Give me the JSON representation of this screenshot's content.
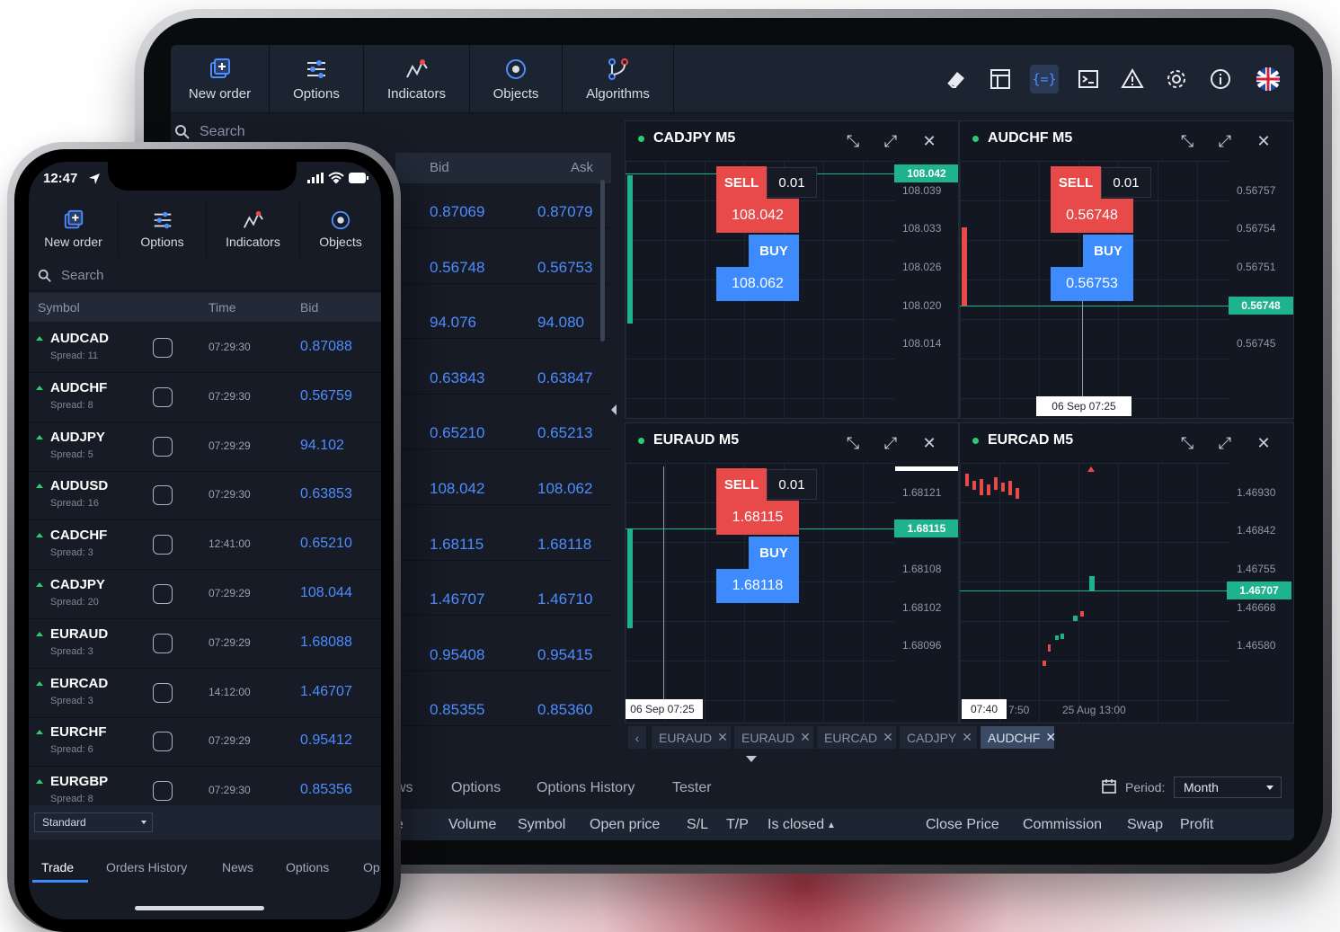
{
  "tablet": {
    "toolbar": [
      {
        "label": "New order",
        "icon": "new-order-icon"
      },
      {
        "label": "Options",
        "icon": "sliders-icon"
      },
      {
        "label": "Indicators",
        "icon": "indicators-icon"
      },
      {
        "label": "Objects",
        "icon": "objects-icon"
      },
      {
        "label": "Algorithms",
        "icon": "algorithms-icon"
      }
    ],
    "search_placeholder": "Search",
    "quotes": {
      "bid_header": "Bid",
      "ask_header": "Ask",
      "rows": [
        {
          "bid": "0.87069",
          "ask": "0.87079"
        },
        {
          "bid": "0.56748",
          "ask": "0.56753"
        },
        {
          "bid": "94.076",
          "ask": "94.080"
        },
        {
          "bid": "0.63843",
          "ask": "0.63847"
        },
        {
          "bid": "0.65210",
          "ask": "0.65213"
        },
        {
          "bid": "108.042",
          "ask": "108.062"
        },
        {
          "bid": "1.68115",
          "ask": "1.68118"
        },
        {
          "bid": "1.46707",
          "ask": "1.46710"
        },
        {
          "bid": "0.95408",
          "ask": "0.95415"
        },
        {
          "bid": "0.85355",
          "ask": "0.85360"
        }
      ]
    },
    "charts": {
      "cadjpy": {
        "title": "CADJPY M5",
        "sell": "SELL",
        "lot": "0.01",
        "sell_price": "108.042",
        "buy": "BUY",
        "buy_price": "108.062",
        "price_tag": "108.042",
        "axis": [
          "108.039",
          "108.033",
          "108.026",
          "108.020",
          "108.014"
        ]
      },
      "audchf": {
        "title": "AUDCHF M5",
        "sell": "SELL",
        "lot": "0.01",
        "sell_price": "0.56748",
        "buy": "BUY",
        "buy_price": "0.56753",
        "price_tag": "0.56748",
        "axis": [
          "0.56757",
          "0.56754",
          "0.56751",
          "0.56745"
        ],
        "time_tag": "06 Sep 07:25"
      },
      "euraud": {
        "title": "EURAUD M5",
        "sell": "SELL",
        "lot": "0.01",
        "sell_price": "1.68115",
        "buy": "BUY",
        "buy_price": "1.68118",
        "price_tag": "1.68115",
        "axis": [
          "1.68121",
          "1.68108",
          "1.68102",
          "1.68096"
        ],
        "time_tag": "06 Sep 07:25"
      },
      "eurcad": {
        "title": "EURCAD M5",
        "price_tag": "1.46707",
        "axis": [
          "1.46930",
          "1.46842",
          "1.46755",
          "1.46668",
          "1.46580"
        ],
        "time_tag": "07:40",
        "time_2": "7:50",
        "time_3": "25 Aug 13:00"
      }
    },
    "symbol_tabs": [
      "EURAUD",
      "EURAUD",
      "EURCAD",
      "CADJPY",
      "AUDCHF"
    ],
    "bottom_tabs": [
      "ws",
      "Options",
      "Options History",
      "Tester"
    ],
    "period_label": "Period:",
    "period_value": "Month",
    "columns": [
      "e",
      "Volume",
      "Symbol",
      "Open price",
      "S/L",
      "T/P",
      "Is closed",
      "Close Price",
      "Commission",
      "Swap",
      "Profit"
    ],
    "colors": {
      "buy": "#3d8bfd",
      "sell": "#e84a4a",
      "price_tag": "#1fb28f"
    }
  },
  "phone": {
    "time": "12:47",
    "toolbar": [
      {
        "label": "New order"
      },
      {
        "label": "Options"
      },
      {
        "label": "Indicators"
      },
      {
        "label": "Objects"
      }
    ],
    "search_placeholder": "Search",
    "headers": {
      "symbol": "Symbol",
      "time": "Time",
      "bid": "Bid"
    },
    "rows": [
      {
        "symbol": "AUDCAD",
        "spread": "Spread: 11",
        "time": "07:29:30",
        "bid": "0.87088"
      },
      {
        "symbol": "AUDCHF",
        "spread": "Spread: 8",
        "time": "07:29:30",
        "bid": "0.56759"
      },
      {
        "symbol": "AUDJPY",
        "spread": "Spread: 5",
        "time": "07:29:29",
        "bid": "94.102"
      },
      {
        "symbol": "AUDUSD",
        "spread": "Spread: 16",
        "time": "07:29:30",
        "bid": "0.63853"
      },
      {
        "symbol": "CADCHF",
        "spread": "Spread: 3",
        "time": "12:41:00",
        "bid": "0.65210"
      },
      {
        "symbol": "CADJPY",
        "spread": "Spread: 20",
        "time": "07:29:29",
        "bid": "108.044"
      },
      {
        "symbol": "EURAUD",
        "spread": "Spread: 3",
        "time": "07:29:29",
        "bid": "1.68088"
      },
      {
        "symbol": "EURCAD",
        "spread": "Spread: 3",
        "time": "14:12:00",
        "bid": "1.46707"
      },
      {
        "symbol": "EURCHF",
        "spread": "Spread: 6",
        "time": "07:29:29",
        "bid": "0.95412"
      },
      {
        "symbol": "EURGBP",
        "spread": "Spread: 8",
        "time": "07:29:30",
        "bid": "0.85356"
      }
    ],
    "account_type": "Standard",
    "bottom_tabs": [
      "Trade",
      "Orders History",
      "News",
      "Options",
      "Op"
    ]
  }
}
